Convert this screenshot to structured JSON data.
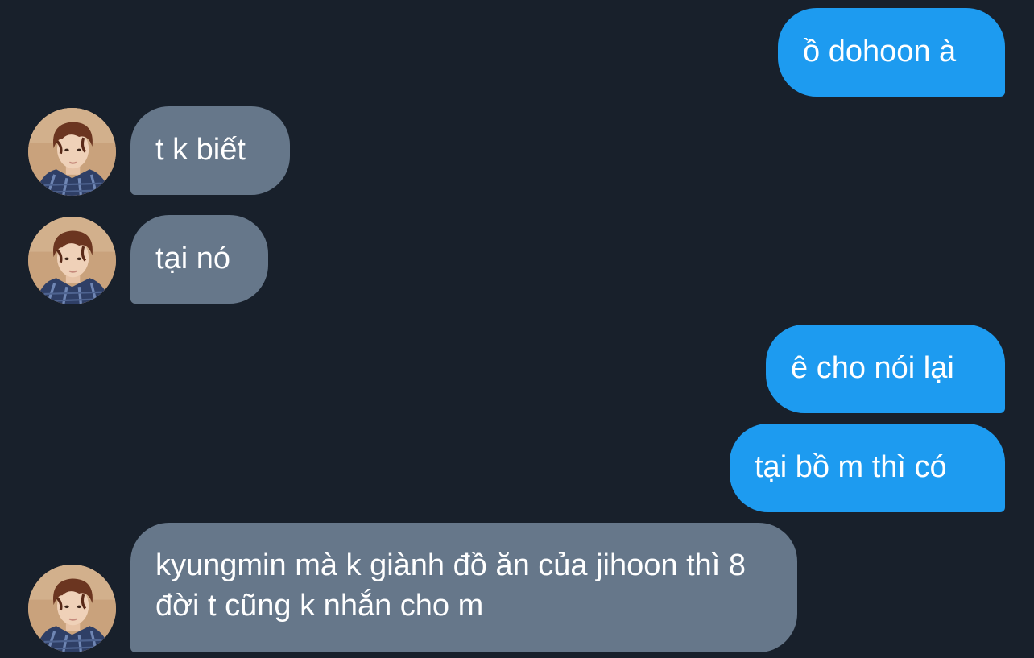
{
  "messages": [
    {
      "id": "m1",
      "direction": "sent",
      "text": "ồ dohoon à"
    },
    {
      "id": "m2",
      "direction": "received",
      "text": "t k biết"
    },
    {
      "id": "m3",
      "direction": "received",
      "text": "tại nó"
    },
    {
      "id": "m4",
      "direction": "sent",
      "text": "ê cho nói lại"
    },
    {
      "id": "m5",
      "direction": "sent",
      "text": "tại bồ m thì có"
    },
    {
      "id": "m6",
      "direction": "received",
      "text": "kyungmin mà k giành đồ ăn của jihoon thì 8 đời t cũng k nhắn cho m"
    }
  ],
  "colors": {
    "background": "#18202b",
    "sent_bubble": "#1d9bf0",
    "received_bubble": "#66778a",
    "text": "#ffffff"
  },
  "icons": {
    "avatar": "contact-avatar-photo"
  }
}
